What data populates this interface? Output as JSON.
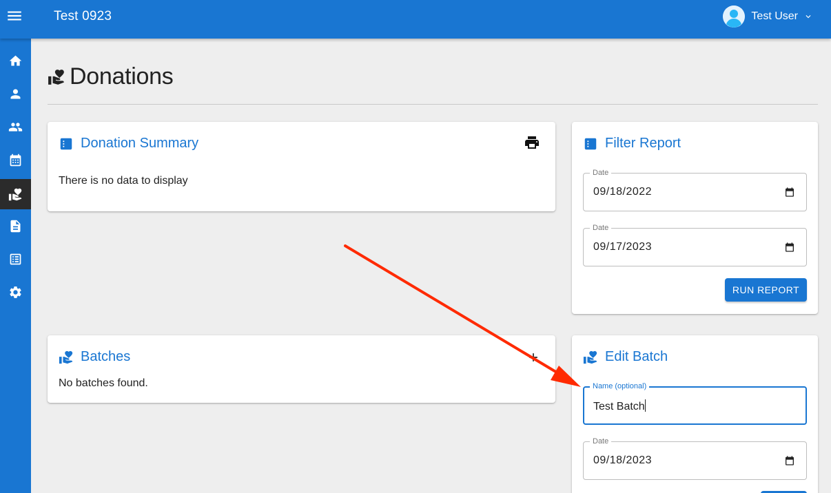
{
  "app": {
    "title": "Test 0923"
  },
  "user": {
    "name": "Test User"
  },
  "sidebar": {
    "items": [
      {
        "icon": "home-icon"
      },
      {
        "icon": "person-icon"
      },
      {
        "icon": "people-icon"
      },
      {
        "icon": "calendar-icon"
      },
      {
        "icon": "donations-icon",
        "active": true
      },
      {
        "icon": "document-icon"
      },
      {
        "icon": "list-icon"
      },
      {
        "icon": "settings-icon"
      }
    ]
  },
  "page": {
    "title": "Donations"
  },
  "donation_summary": {
    "title": "Donation Summary",
    "empty_text": "There is no data to display",
    "print_icon": "print-icon"
  },
  "filter_report": {
    "title": "Filter Report",
    "start_date_label": "Date",
    "start_date_value": "09/18/2022",
    "end_date_label": "Date",
    "end_date_value": "09/17/2023",
    "run_button": "RUN REPORT"
  },
  "batches": {
    "title": "Batches",
    "empty_text": "No batches found.",
    "add_icon": "plus-icon"
  },
  "edit_batch": {
    "title": "Edit Batch",
    "name_label": "Name (optional)",
    "name_value": "Test Batch",
    "date_label": "Date",
    "date_value": "09/18/2023"
  },
  "colors": {
    "primary": "#1976d2",
    "sidebar_active": "#2b2b2b",
    "annotation_arrow": "#ff2a00",
    "background": "#eeeeee"
  }
}
